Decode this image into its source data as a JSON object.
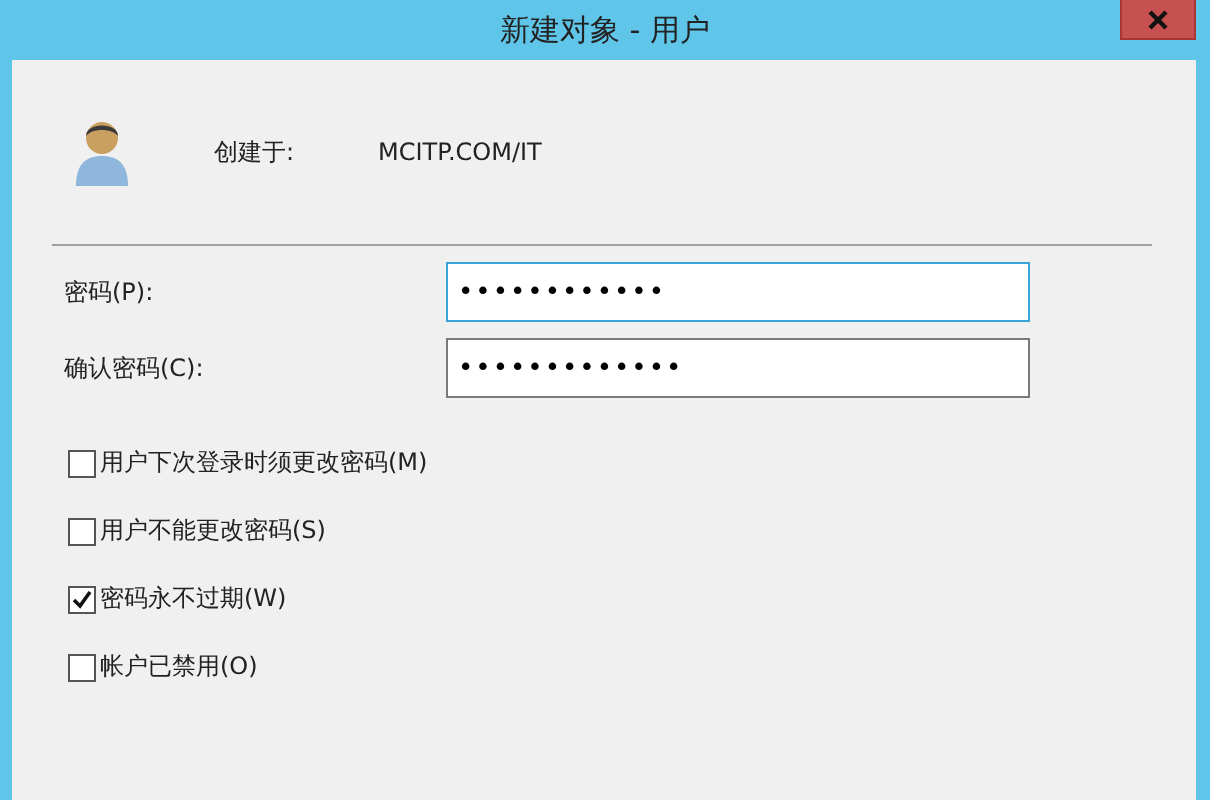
{
  "window": {
    "title": "新建对象 - 用户"
  },
  "header": {
    "label": "创建于:",
    "value": "MCITP.COM/IT"
  },
  "fields": [
    {
      "label": "密码(P):",
      "value": "••••••••••••",
      "highlighted": true
    },
    {
      "label": "确认密码(C):",
      "value": "•••••••••••••",
      "highlighted": false
    }
  ],
  "options": [
    {
      "label": "用户下次登录时须更改密码(M)",
      "checked": false
    },
    {
      "label": "用户不能更改密码(S)",
      "checked": false
    },
    {
      "label": "密码永不过期(W)",
      "checked": true
    },
    {
      "label": "帐户已禁用(O)",
      "checked": false
    }
  ]
}
